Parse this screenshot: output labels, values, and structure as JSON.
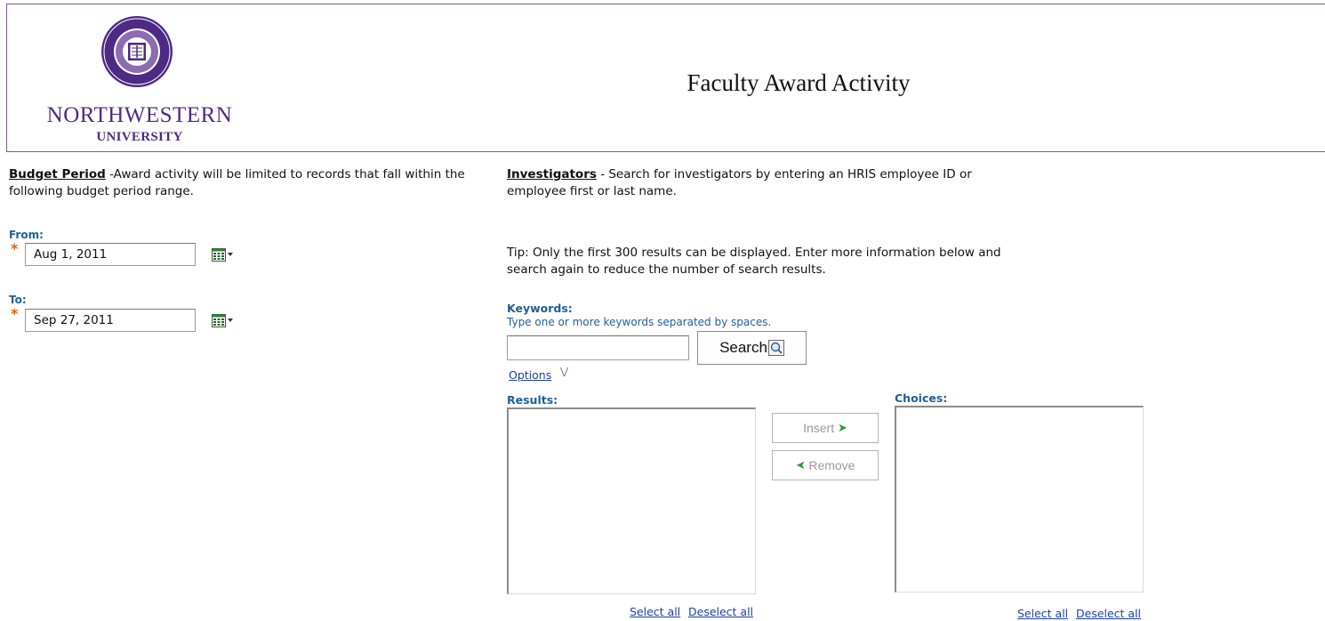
{
  "header": {
    "logo_wordmark": "NORTHWESTERN",
    "logo_sub": "UNIVERSITY",
    "seal_text": "NORTHWESTERN UNIVERSITY 1851",
    "title": "Faculty Award Activity"
  },
  "budget": {
    "heading": "Budget Period",
    "description": " -Award activity will be limited to records that fall within the following budget period range.",
    "from_label": "From:",
    "from_value": "Aug 1, 2011",
    "to_label": "To:",
    "to_value": "Sep 27, 2011",
    "required_mark": "*",
    "calendar_icon": "calendar-icon"
  },
  "investigators": {
    "heading": "Investigators",
    "description": " - Search for investigators by entering an HRIS employee ID or employee first or last name.",
    "tip": "Tip: Only the first 300 results can be displayed. Enter more information below and search again to reduce the number of search results.",
    "keywords_label": "Keywords:",
    "keywords_hint": "Type one or more keywords separated by spaces.",
    "keywords_value": "",
    "search_label": "Search",
    "options_label": "Options",
    "results_label": "Results:",
    "choices_label": "Choices:",
    "insert_label": "Insert",
    "remove_label": "Remove",
    "select_all": "Select all",
    "deselect_all": "Deselect all"
  },
  "colors": {
    "brand_purple": "#4e2a84",
    "label_blue": "#1f5f9a",
    "link_blue": "#1c3fa8",
    "required_orange": "#e0640f",
    "arrow_green": "#2e9b2e"
  }
}
